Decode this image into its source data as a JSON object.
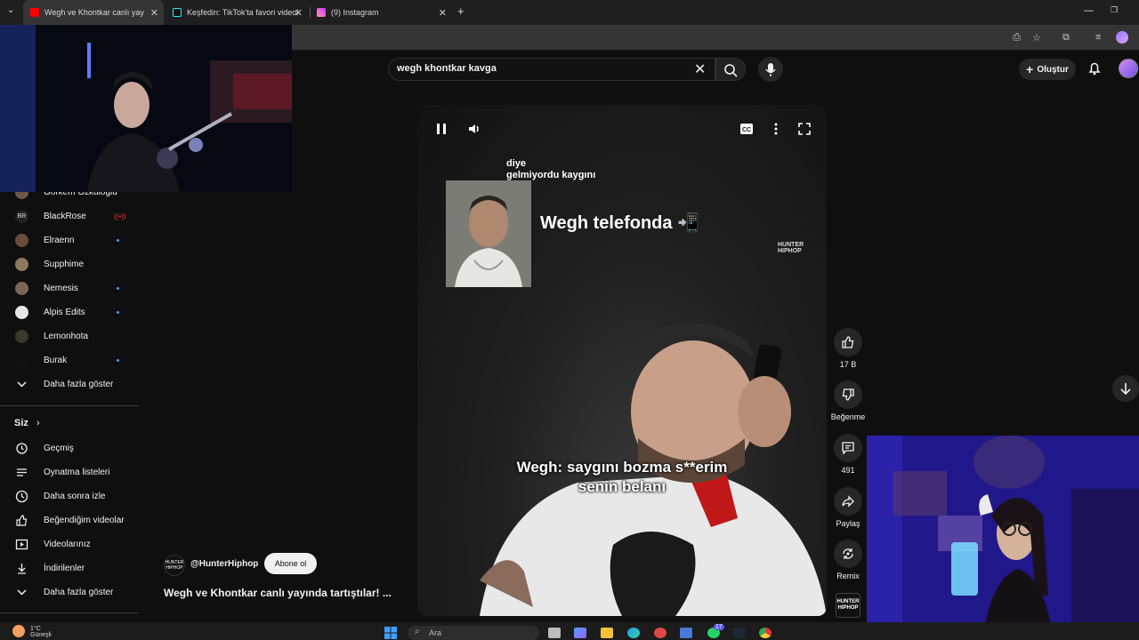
{
  "browser": {
    "tabs": [
      {
        "title": "Wegh ve Khontkar canlı yay",
        "active": true
      },
      {
        "title": "Keşfedin: TikTok'ta favori videol",
        "active": false
      },
      {
        "title": "(9) Instagram",
        "active": false
      }
    ],
    "new_tab": "+"
  },
  "search": {
    "query": "wegh khontkar kavga"
  },
  "header": {
    "create_label": "Oluştur"
  },
  "sidebar": {
    "subscriptions": [
      {
        "name": "Görkem Özkuloğlu",
        "indicator": "none"
      },
      {
        "name": "BlackRose",
        "indicator": "live"
      },
      {
        "name": "Elraenn",
        "indicator": "dot"
      },
      {
        "name": "Supphime",
        "indicator": "none"
      },
      {
        "name": "Nemesis",
        "indicator": "dot"
      },
      {
        "name": "Alpis Edits",
        "indicator": "dot"
      },
      {
        "name": "Lemonhota",
        "indicator": "none"
      },
      {
        "name": "Burak",
        "indicator": "dot"
      }
    ],
    "show_more_subs": "Daha fazla göster",
    "you_header": "Siz",
    "you_items": [
      {
        "label": "Geçmiş",
        "icon": "history-icon"
      },
      {
        "label": "Oynatma listeleri",
        "icon": "playlist-icon"
      },
      {
        "label": "Daha sonra izle",
        "icon": "clock-icon"
      },
      {
        "label": "Beğendiğim videolar",
        "icon": "thumbs-up-icon"
      },
      {
        "label": "Videolarınız",
        "icon": "video-icon"
      },
      {
        "label": "İndirilenler",
        "icon": "download-icon"
      }
    ],
    "show_more_you": "Daha fazla göster"
  },
  "video": {
    "overlay_small_1": "diye",
    "overlay_small_2": "gelmiyordu kaygını",
    "overlay_headline": "Wegh telefonda 📲",
    "brand": "HUNTER HIPHOP",
    "caption_line1": "Wegh: saygını bozma s**erim",
    "caption_line2": "senin belanı"
  },
  "actions": {
    "like_count": "17 B",
    "dislike_label": "Beğenme",
    "comment_count": "491",
    "share_label": "Paylaş",
    "remix_label": "Remix"
  },
  "channel": {
    "handle": "@HunterHiphop",
    "subscribe_label": "Abone ol",
    "video_title": "Wegh ve Khontkar canlı yayında tartıştılar! ..."
  },
  "taskbar": {
    "search_label": "Ara",
    "weather_temp": "1°C",
    "weather_desc": "Güneşli",
    "badge_count": "17"
  },
  "colors": {
    "live": "#ff3030",
    "dot": "#3ea6ff",
    "accent_tab": "#ff0000"
  }
}
